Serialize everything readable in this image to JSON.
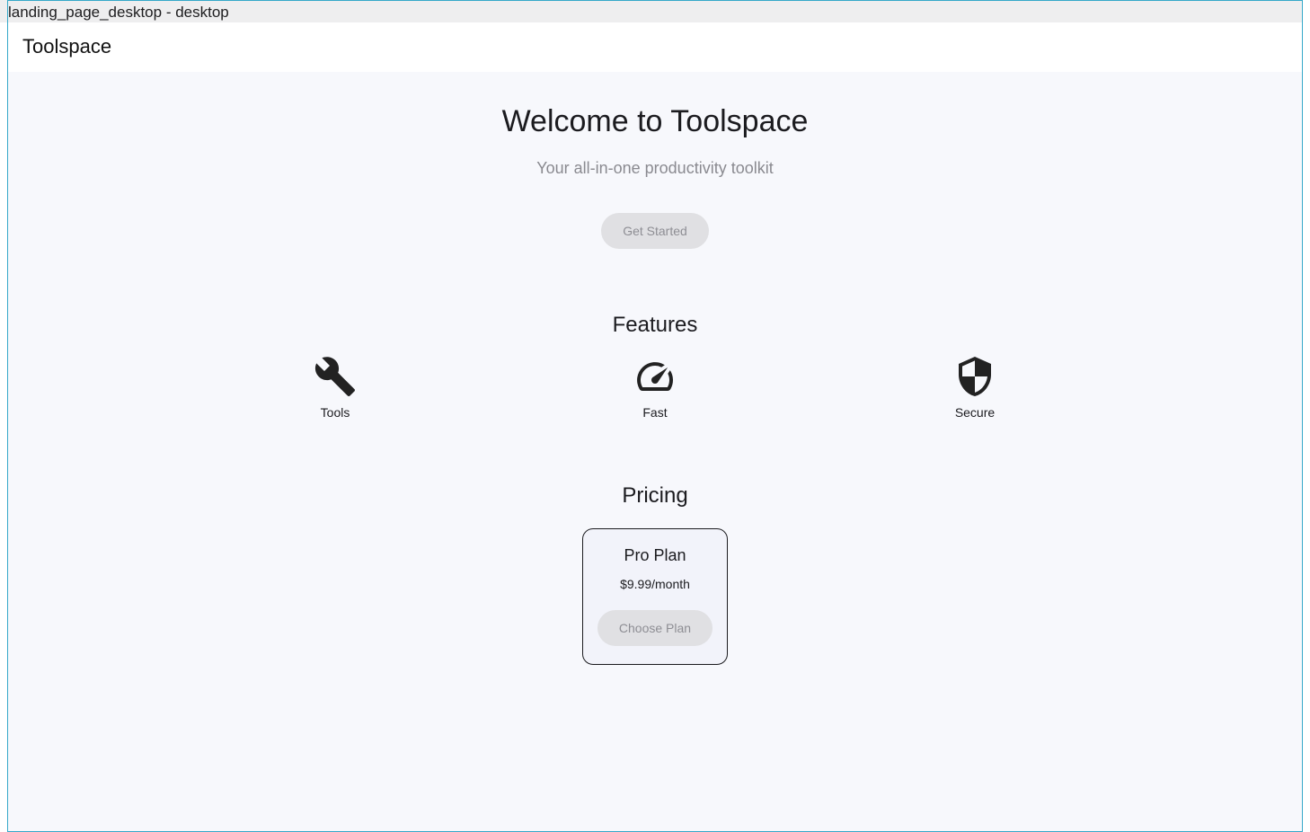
{
  "frame": {
    "title": "landing_page_desktop - desktop"
  },
  "app_bar": {
    "title": "Toolspace"
  },
  "hero": {
    "title": "Welcome to Toolspace",
    "subtitle": "Your all-in-one productivity toolkit",
    "cta_label": "Get Started"
  },
  "features": {
    "heading": "Features",
    "items": [
      {
        "label": "Tools",
        "icon": "wrench-icon"
      },
      {
        "label": "Fast",
        "icon": "speedometer-icon"
      },
      {
        "label": "Secure",
        "icon": "shield-icon"
      }
    ]
  },
  "pricing": {
    "heading": "Pricing",
    "plan": {
      "name": "Pro Plan",
      "price": "$9.99/month",
      "cta_label": "Choose Plan"
    }
  },
  "colors": {
    "page_background": "#f7f8fc",
    "app_bar_background": "#ffffff",
    "text_primary": "#1b1b1f",
    "text_secondary": "#8a8a90",
    "disabled_button": "#e0e0e3",
    "card_background": "#f2f3fa",
    "device_border": "#35a8c9"
  }
}
